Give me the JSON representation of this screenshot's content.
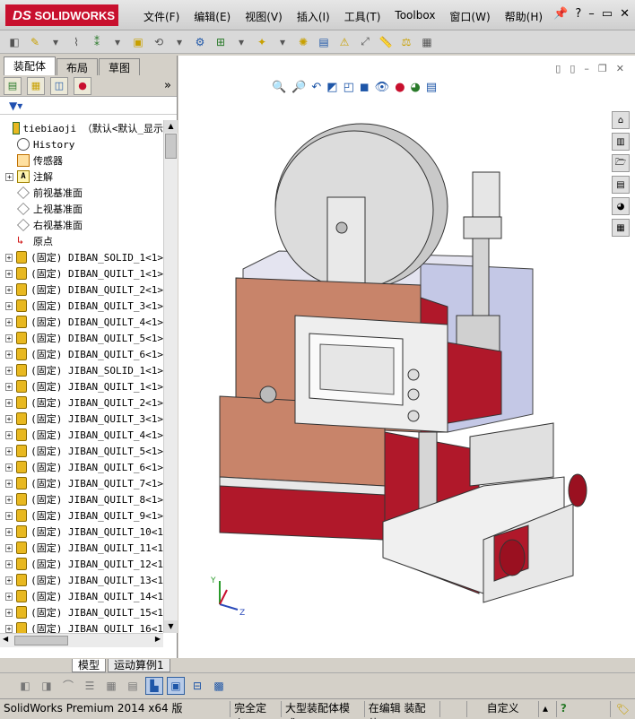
{
  "app": {
    "logo": "SOLIDWORKS"
  },
  "menu": [
    "文件(F)",
    "编辑(E)",
    "视图(V)",
    "插入(I)",
    "工具(T)",
    "Toolbox",
    "窗口(W)",
    "帮助(H)"
  ],
  "window_controls": {
    "help": "?",
    "min": "–",
    "restore": "▭",
    "close": "✕"
  },
  "panel_tabs": [
    "装配体",
    "布局",
    "草图"
  ],
  "tree": {
    "root": "tiebiaoji （默认<默认_显示",
    "items": [
      {
        "label": "History",
        "icon": "history-icon",
        "expand": false
      },
      {
        "label": "传感器",
        "icon": "sensor-icon",
        "expand": false
      },
      {
        "label": "注解",
        "icon": "annotation-icon",
        "expand": true
      },
      {
        "label": "前视基准面",
        "icon": "plane-icon",
        "expand": false
      },
      {
        "label": "上视基准面",
        "icon": "plane-icon",
        "expand": false
      },
      {
        "label": "右视基准面",
        "icon": "plane-icon",
        "expand": false
      },
      {
        "label": "原点",
        "icon": "origin-icon",
        "expand": false
      },
      {
        "label": "(固定) DIBAN_SOLID_1<1>",
        "icon": "part-icon",
        "expand": true
      },
      {
        "label": "(固定) DIBAN_QUILT_1<1>",
        "icon": "part-icon",
        "expand": true
      },
      {
        "label": "(固定) DIBAN_QUILT_2<1>",
        "icon": "part-icon",
        "expand": true
      },
      {
        "label": "(固定) DIBAN_QUILT_3<1>",
        "icon": "part-icon",
        "expand": true
      },
      {
        "label": "(固定) DIBAN_QUILT_4<1>",
        "icon": "part-icon",
        "expand": true
      },
      {
        "label": "(固定) DIBAN_QUILT_5<1>",
        "icon": "part-icon",
        "expand": true
      },
      {
        "label": "(固定) DIBAN_QUILT_6<1>",
        "icon": "part-icon",
        "expand": true
      },
      {
        "label": "(固定) JIBAN_SOLID_1<1>",
        "icon": "part-icon",
        "expand": true
      },
      {
        "label": "(固定) JIBAN_QUILT_1<1>",
        "icon": "part-icon",
        "expand": true
      },
      {
        "label": "(固定) JIBAN_QUILT_2<1>",
        "icon": "part-icon",
        "expand": true
      },
      {
        "label": "(固定) JIBAN_QUILT_3<1>",
        "icon": "part-icon",
        "expand": true
      },
      {
        "label": "(固定) JIBAN_QUILT_4<1>",
        "icon": "part-icon",
        "expand": true
      },
      {
        "label": "(固定) JIBAN_QUILT_5<1>",
        "icon": "part-icon",
        "expand": true
      },
      {
        "label": "(固定) JIBAN_QUILT_6<1>",
        "icon": "part-icon",
        "expand": true
      },
      {
        "label": "(固定) JIBAN_QUILT_7<1>",
        "icon": "part-icon",
        "expand": true
      },
      {
        "label": "(固定) JIBAN_QUILT_8<1>",
        "icon": "part-icon",
        "expand": true
      },
      {
        "label": "(固定) JIBAN_QUILT_9<1>",
        "icon": "part-icon",
        "expand": true
      },
      {
        "label": "(固定) JIBAN_QUILT_10<1",
        "icon": "part-icon",
        "expand": true
      },
      {
        "label": "(固定) JIBAN_QUILT_11<1",
        "icon": "part-icon",
        "expand": true
      },
      {
        "label": "(固定) JIBAN_QUILT_12<1",
        "icon": "part-icon",
        "expand": true
      },
      {
        "label": "(固定) JIBAN_QUILT_13<1",
        "icon": "part-icon",
        "expand": true
      },
      {
        "label": "(固定) JIBAN_QUILT_14<1",
        "icon": "part-icon",
        "expand": true
      },
      {
        "label": "(固定) JIBAN_QUILT_15<1",
        "icon": "part-icon",
        "expand": true
      },
      {
        "label": "(固定) JIBAN_QUILT_16<1",
        "icon": "part-icon",
        "expand": true
      }
    ]
  },
  "bottom_tabs": [
    "模型",
    "运动算例1"
  ],
  "status": [
    "SolidWorks Premium 2014 x64 版",
    "完全定义",
    "大型装配体模式",
    "在编辑 装配体",
    "自定义"
  ],
  "colors": {
    "brand": "#c8102e",
    "accent": "#1e56a8",
    "model_red": "#b0182a",
    "model_copper": "#c8846a"
  }
}
